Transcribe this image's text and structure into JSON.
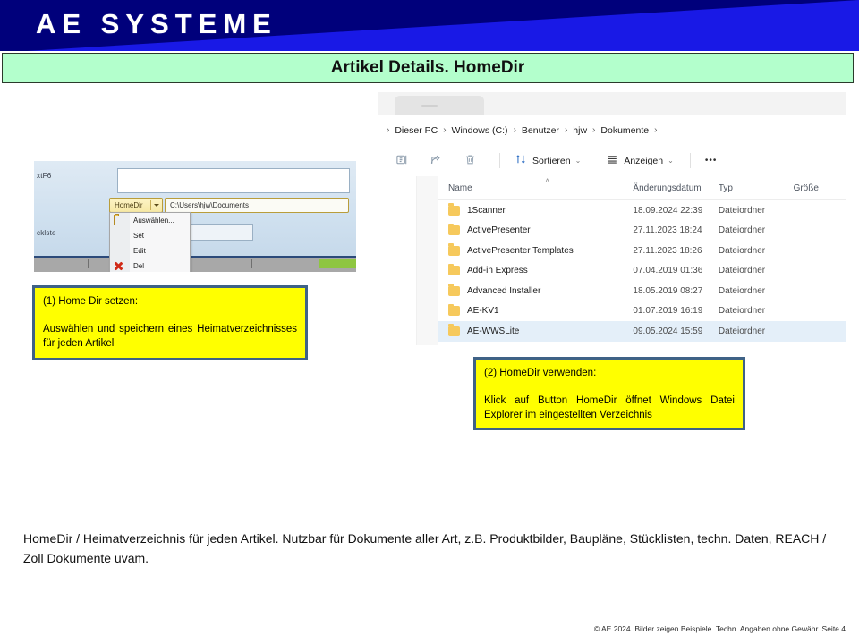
{
  "header": {
    "logo_text": "AE SYSTEME",
    "banner_dark_color": "#00007b",
    "banner_bright_color": "#1919e6"
  },
  "title_bar": {
    "title": "Artikel Details. HomeDir",
    "background_color": "#b3ffcc"
  },
  "app_dialog": {
    "label_top": "xtF6",
    "label_left": "cklste",
    "homedir_button": "HomeDir",
    "path_value": "C:\\Users\\hjw\\Documents",
    "menu": [
      {
        "label": "Auswählen...",
        "icon": "folder-icon"
      },
      {
        "label": "Set",
        "icon": ""
      },
      {
        "label": "Edit",
        "icon": ""
      },
      {
        "label": "Del",
        "icon": "red-x-icon"
      }
    ]
  },
  "explorer": {
    "breadcrumb": [
      "Dieser PC",
      "Windows (C:)",
      "Benutzer",
      "hjw",
      "Dokumente"
    ],
    "breadcrumb_separator": "›",
    "toolbar": {
      "rename_icon": "rename-icon",
      "share_icon": "share-icon",
      "delete_icon": "trash-icon",
      "sort_label": "Sortieren",
      "sort_icon": "sort-arrows-icon",
      "view_label": "Anzeigen",
      "view_icon": "list-view-icon",
      "caret": "⌄",
      "overflow_label": "•••"
    },
    "columns": {
      "name": "Name",
      "date": "Änderungsdatum",
      "type": "Typ",
      "size": "Größe",
      "sort_indicator": "˄"
    },
    "rows": [
      {
        "name": "1Scanner",
        "date": "18.09.2024 22:39",
        "type": "Dateiordner",
        "size": "",
        "selected": false
      },
      {
        "name": "ActivePresenter",
        "date": "27.11.2023 18:24",
        "type": "Dateiordner",
        "size": "",
        "selected": false
      },
      {
        "name": "ActivePresenter Templates",
        "date": "27.11.2023 18:26",
        "type": "Dateiordner",
        "size": "",
        "selected": false
      },
      {
        "name": "Add-in Express",
        "date": "07.04.2019 01:36",
        "type": "Dateiordner",
        "size": "",
        "selected": false
      },
      {
        "name": "Advanced Installer",
        "date": "18.05.2019 08:27",
        "type": "Dateiordner",
        "size": "",
        "selected": false
      },
      {
        "name": "AE-KV1",
        "date": "01.07.2019 16:19",
        "type": "Dateiordner",
        "size": "",
        "selected": false
      },
      {
        "name": "AE-WWSLite",
        "date": "09.05.2024 15:59",
        "type": "Dateiordner",
        "size": "",
        "selected": true
      }
    ]
  },
  "callouts": [
    {
      "title": "(1) Home Dir setzen:",
      "body": "Auswählen und speichern eines Heimatverzeichnisses für jeden Artikel",
      "fill_color": "#ffff00",
      "border_color": "#3f6286"
    },
    {
      "title": "(2) HomeDir verwenden:",
      "body": "Klick auf Button HomeDir öffnet Windows Datei Explorer im eingestellten Verzeichnis",
      "fill_color": "#ffff00",
      "border_color": "#3f6286"
    }
  ],
  "body_text": "HomeDir / Heimatverzeichnis für jeden Artikel. Nutzbar für Dokumente aller Art, z.B. Produktbilder, Baupläne, Stücklisten, techn. Daten, REACH / Zoll Dokumente uvam.",
  "footer": "© AE 2024. Bilder zeigen Beispiele. Techn. Angaben ohne Gewähr. Seite 4"
}
